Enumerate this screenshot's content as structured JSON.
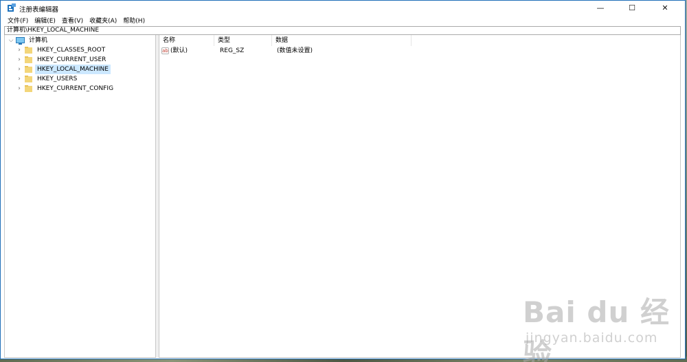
{
  "window": {
    "title": "注册表编辑器",
    "controls": {
      "minimize": "—",
      "maximize": "☐",
      "close": "✕"
    }
  },
  "menu": [
    "文件(F)",
    "编辑(E)",
    "查看(V)",
    "收藏夹(A)",
    "帮助(H)"
  ],
  "address": "计算机\\HKEY_LOCAL_MACHINE",
  "tree": {
    "root": {
      "label": "计算机",
      "expanded": true
    },
    "children": [
      {
        "label": "HKEY_CLASSES_ROOT",
        "selected": false
      },
      {
        "label": "HKEY_CURRENT_USER",
        "selected": false
      },
      {
        "label": "HKEY_LOCAL_MACHINE",
        "selected": true
      },
      {
        "label": "HKEY_USERS",
        "selected": false
      },
      {
        "label": "HKEY_CURRENT_CONFIG",
        "selected": false
      }
    ]
  },
  "list": {
    "columns": [
      "名称",
      "类型",
      "数据"
    ],
    "rows": [
      {
        "name": "(默认)",
        "type": "REG_SZ",
        "data": "(数值未设置)",
        "icon": "ab-string-icon"
      }
    ]
  },
  "watermark": {
    "logo": "Bai du 经验",
    "url": "jingyan.baidu.com"
  },
  "colors": {
    "selection": "#cce8ff",
    "accent": "#1f6fb8"
  }
}
